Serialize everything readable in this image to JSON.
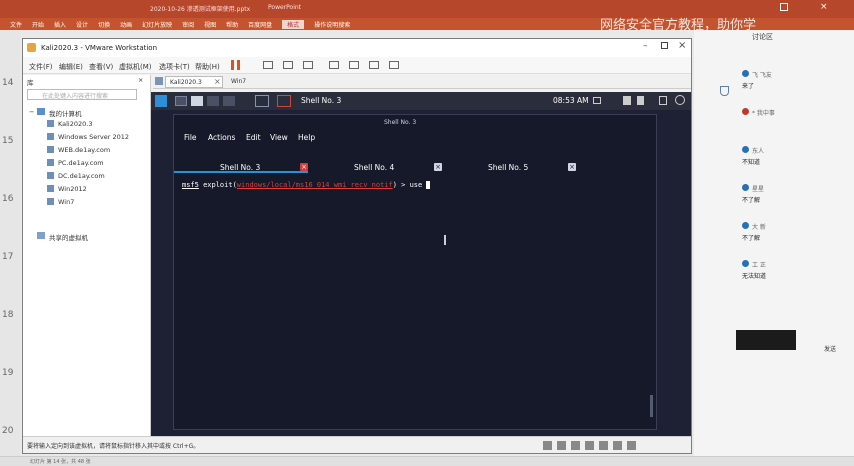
{
  "powerpoint": {
    "title_doc": "2020-10-26 渗透测试框架使用.pptx",
    "title_app": "PowerPoint",
    "ribbon_tabs": [
      "文件",
      "开始",
      "插入",
      "设计",
      "切换",
      "动画",
      "幻灯片放映",
      "审阅",
      "视图",
      "帮助",
      "百度网盘",
      "格式",
      "操作说明搜索"
    ],
    "active_tab": "格式",
    "slide_numbers": [
      "14",
      "15",
      "16",
      "17",
      "18",
      "19",
      "20"
    ],
    "status_bar": "幻灯片 第 14 张，共 48 张",
    "watermark": "网络安全官方教程，助你学",
    "right_panel": {
      "title": "讨论区",
      "messages": [
        {
          "user": "飞 飞友",
          "text": "来了"
        },
        {
          "user": "* 我中事",
          "text": ""
        },
        {
          "user": "东人",
          "text": "不知道"
        },
        {
          "user": "星星",
          "text": "不了解"
        },
        {
          "user": "大 新",
          "text": "不了解"
        },
        {
          "user": "工 正",
          "text": "无法知道"
        }
      ],
      "footer": "发送"
    }
  },
  "vmware": {
    "window_title": "Kali2020.3 - VMware Workstation",
    "menu": [
      "文件(F)",
      "编辑(E)",
      "查看(V)",
      "虚拟机(M)",
      "选项卡(T)",
      "帮助(H)"
    ],
    "library": {
      "heading": "库",
      "search_placeholder": "在此处键入内容进行搜索",
      "my_computer": "我的计算机",
      "vms": [
        "Kali2020.3",
        "Windows Server 2012",
        "WEB.de1ay.com",
        "PC.de1ay.com",
        "DC.de1ay.com",
        "Win2012",
        "Win7"
      ],
      "shared": "共享的虚拟机"
    },
    "tabs": [
      "Kali2020.3",
      "Win7"
    ],
    "status_text": "要将输入定向到该虚拟机，请将鼠标指针移入其中或按 Ctrl+G。"
  },
  "kali": {
    "clock": "08:53 AM",
    "window_title": "Shell No. 3",
    "panel_active_title": "Shell No. 3",
    "menu": [
      "File",
      "Actions",
      "Edit",
      "View",
      "Help"
    ],
    "tabs": [
      "Shell No. 3",
      "Shell No. 4",
      "Shell No. 5"
    ],
    "active_tab": 0,
    "prompt_module": "msf5",
    "prompt_cmd": "exploit(",
    "prompt_path": "windows/local/ms16_014_wmi_recv_notif",
    "prompt_tail": ") > use "
  }
}
